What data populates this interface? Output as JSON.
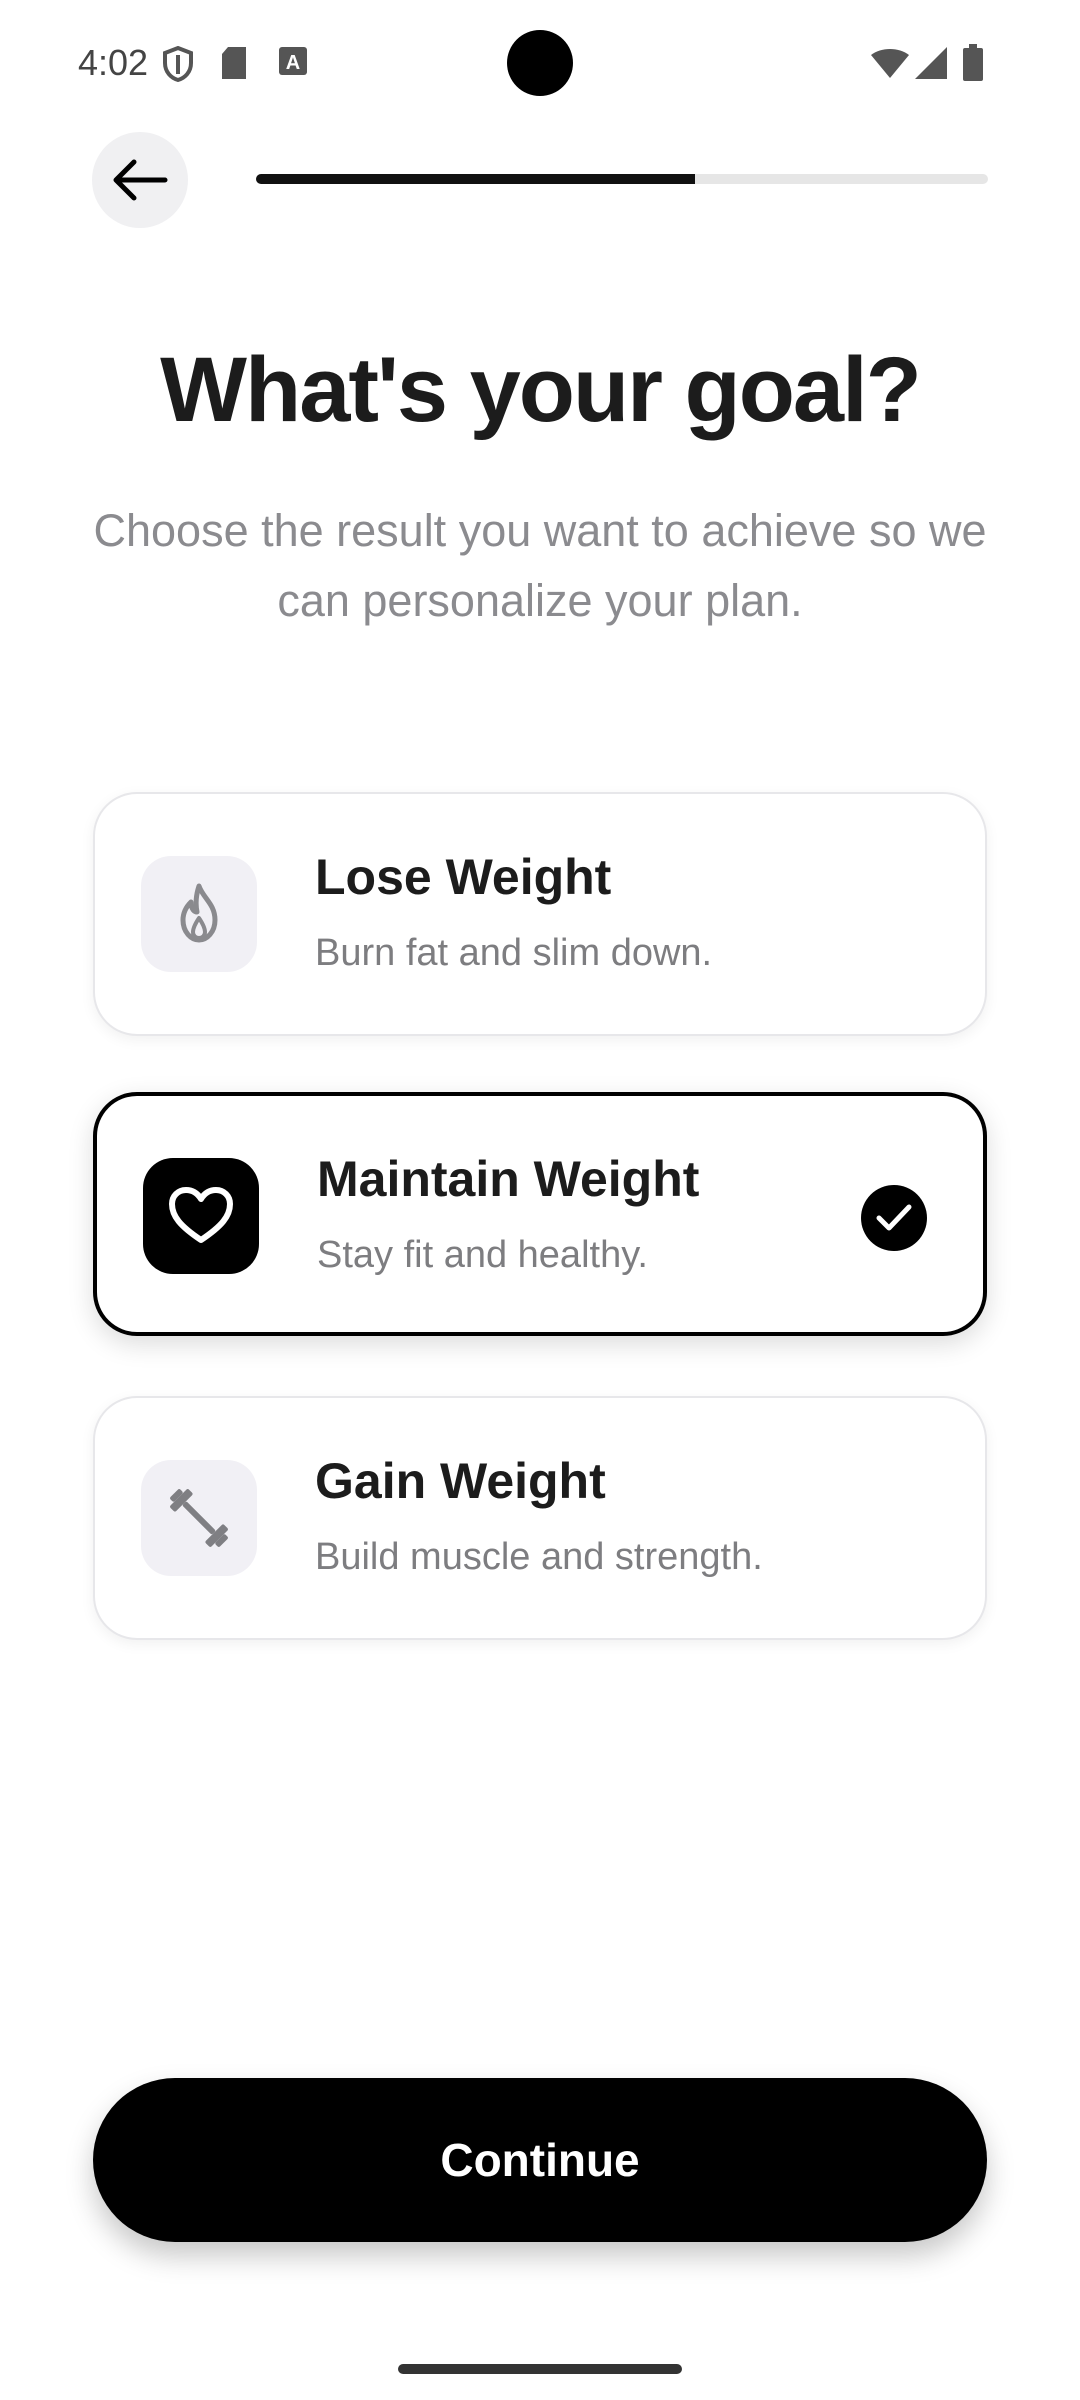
{
  "status_bar": {
    "time": "4:02",
    "left_icons": [
      "shield-icon",
      "sd-card-icon",
      "keyboard-a-icon"
    ],
    "right_icons": [
      "wifi-icon",
      "signal-icon",
      "battery-icon"
    ]
  },
  "header": {
    "back_icon": "arrow-left-icon",
    "progress_fraction": 0.6
  },
  "title": "What's your goal?",
  "subtitle": "Choose the result you want to achieve so we can personalize your plan.",
  "options": [
    {
      "title": "Lose Weight",
      "description": "Burn fat and slim down.",
      "icon": "flame-icon",
      "selected": false
    },
    {
      "title": "Maintain Weight",
      "description": "Stay fit and healthy.",
      "icon": "heart-icon",
      "selected": true
    },
    {
      "title": "Gain Weight",
      "description": "Build muscle and strength.",
      "icon": "dumbbell-icon",
      "selected": false
    }
  ],
  "continue_label": "Continue",
  "colors": {
    "accent": "#000000",
    "icon_bg": "#f1f0f5",
    "muted_text": "#8b8b8f"
  }
}
